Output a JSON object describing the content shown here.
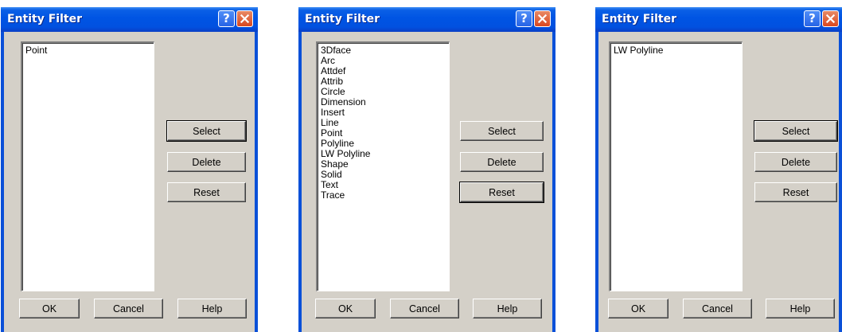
{
  "dialogs": [
    {
      "title": "Entity Filter",
      "items": [
        "Point"
      ],
      "buttons": {
        "select": "Select",
        "delete": "Delete",
        "reset": "Reset",
        "ok": "OK",
        "cancel": "Cancel",
        "help": "Help"
      },
      "default_button": "select"
    },
    {
      "title": "Entity Filter",
      "items": [
        "3Dface",
        "Arc",
        "Attdef",
        "Attrib",
        "Circle",
        "Dimension",
        "Insert",
        "Line",
        "Point",
        "Polyline",
        "LW Polyline",
        "Shape",
        "Solid",
        "Text",
        "Trace"
      ],
      "buttons": {
        "select": "Select",
        "delete": "Delete",
        "reset": "Reset",
        "ok": "OK",
        "cancel": "Cancel",
        "help": "Help"
      },
      "default_button": "reset"
    },
    {
      "title": "Entity Filter",
      "items": [
        "LW Polyline"
      ],
      "buttons": {
        "select": "Select",
        "delete": "Delete",
        "reset": "Reset",
        "ok": "OK",
        "cancel": "Cancel",
        "help": "Help"
      },
      "default_button": "select"
    }
  ],
  "icons": {
    "help": "help-icon",
    "close": "close-icon"
  },
  "colors": {
    "titlebar": "#0054e3",
    "frame": "#0a50d8",
    "face": "#d4d0c8",
    "close": "#d9471f"
  }
}
